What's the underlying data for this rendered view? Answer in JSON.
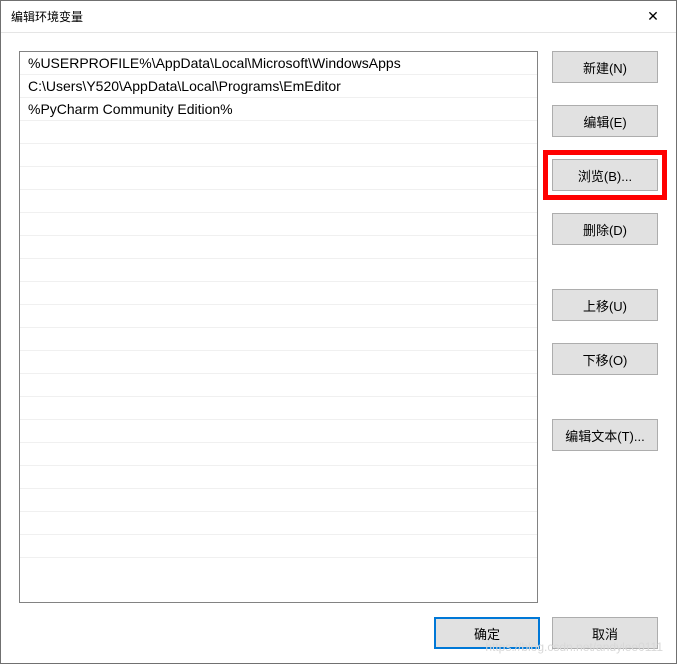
{
  "window": {
    "title": "编辑环境变量",
    "close_glyph": "✕"
  },
  "list": {
    "items": [
      "%USERPROFILE%\\AppData\\Local\\Microsoft\\WindowsApps",
      "C:\\Users\\Y520\\AppData\\Local\\Programs\\EmEditor",
      "%PyCharm Community Edition%"
    ]
  },
  "buttons": {
    "new": "新建(N)",
    "edit": "编辑(E)",
    "browse": "浏览(B)...",
    "delete": "删除(D)",
    "move_up": "上移(U)",
    "move_down": "下移(O)",
    "edit_text": "编辑文本(T)..."
  },
  "footer": {
    "ok": "确定",
    "cancel": "取消"
  },
  "watermark": "https://blog.csdn.net/andylee0111",
  "highlight": {
    "target": "browse",
    "color": "#ff0000"
  }
}
